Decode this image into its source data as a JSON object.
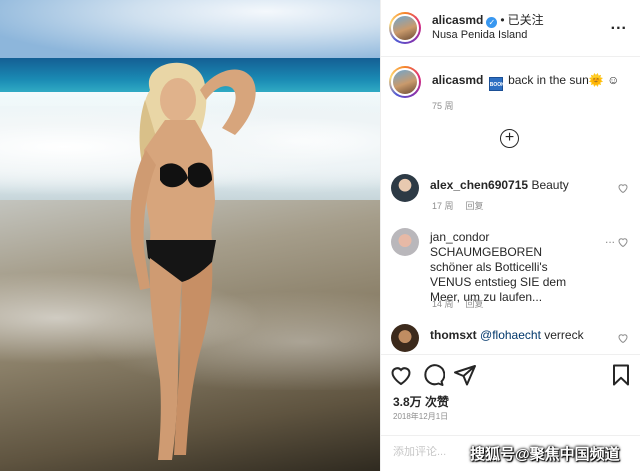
{
  "header": {
    "username": "alicasmd",
    "separator": "•",
    "follow_status": "已关注",
    "location": "Nusa Penida Island",
    "more": "..."
  },
  "caption": {
    "username": "alicasmd",
    "badge": "BOOK",
    "text": "back in the sun",
    "emoji1": "🌞",
    "emoji2": "☺",
    "timestamp": "75 周"
  },
  "load_more": "+",
  "comments": [
    {
      "username": "alex_chen690715",
      "text": "Beauty",
      "time": "17 周",
      "reply": "回复"
    },
    {
      "username": "jan_condor",
      "text": "SCHAUMGEBOREN schöner als Botticelli's VENUS entstieg SIE dem Meer, um zu laufen...",
      "time": "14 周",
      "reply": "回复",
      "more": "..."
    },
    {
      "username": "thomsxt",
      "mention": "@flohaecht",
      "text": "verreck"
    }
  ],
  "engagement": {
    "likes": "3.8万 次赞",
    "date": "2018年12月1日"
  },
  "add_comment": {
    "placeholder": "添加评论..."
  },
  "watermark": "搜狐号@聚焦中国频道",
  "colors": {
    "link": "#00376b",
    "verified": "#3897f0",
    "muted": "#8e8e8e"
  }
}
